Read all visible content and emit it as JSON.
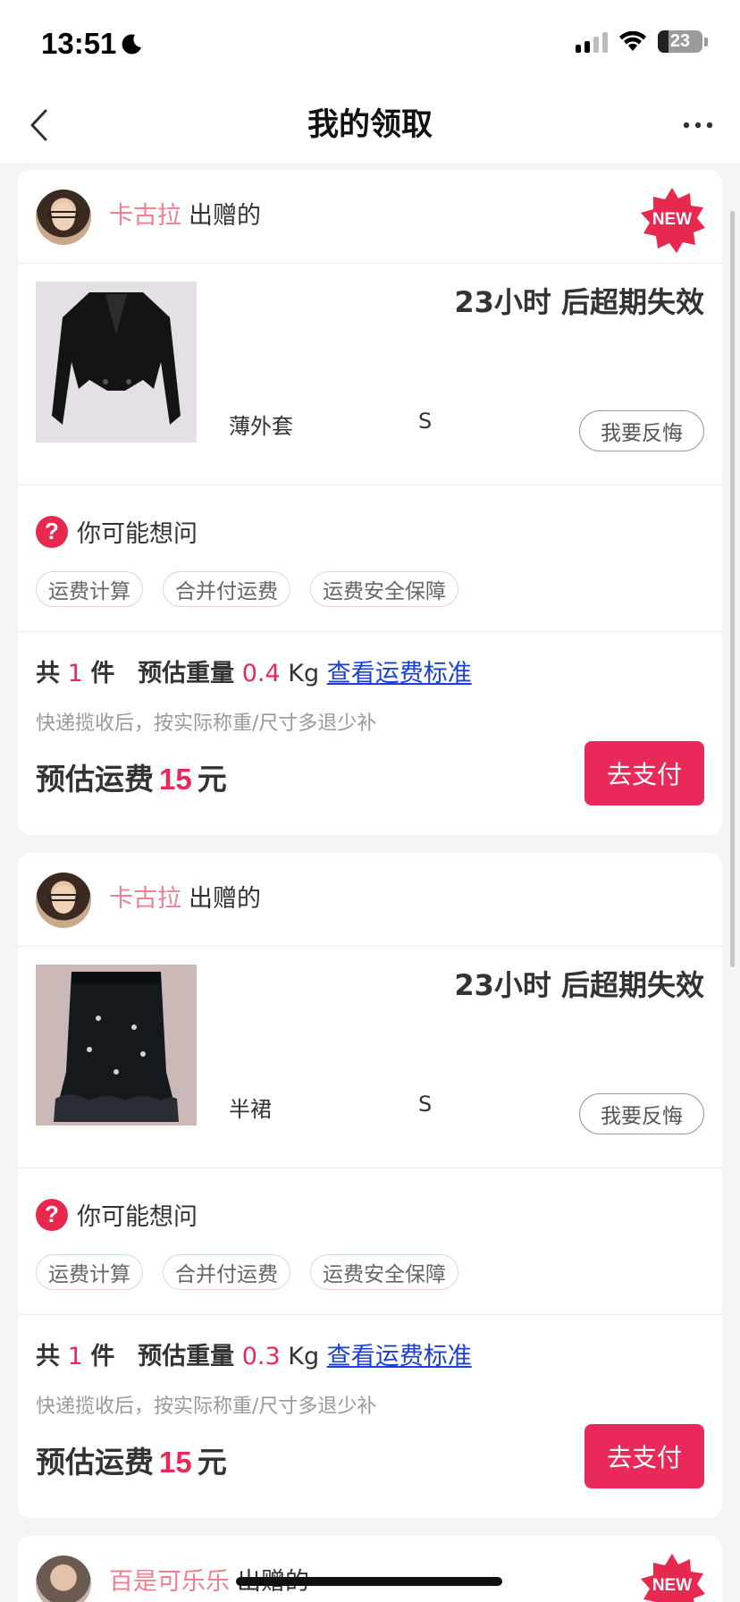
{
  "status": {
    "time": "13:51",
    "battery": "23",
    "moon_icon": "moon-icon",
    "signal_icon": "signal-icon",
    "wifi_icon": "wifi-icon"
  },
  "nav": {
    "title": "我的领取",
    "back_icon": "chevron-left-icon",
    "more_icon": "more-icon"
  },
  "colors": {
    "accent": "#e8295a",
    "giver_name": "#f07f8f",
    "link": "#1a3fd6"
  },
  "cards": [
    {
      "giver_name": "卡古拉",
      "giver_suffix": "出赠的",
      "badge": "NEW",
      "expire_text": "23小时 后超期失效",
      "product_name": "薄外套",
      "size": "S",
      "regret_label": "我要反悔",
      "faq_title": "你可能想问",
      "faq_tags": [
        "运费计算",
        "合并付运费",
        "运费安全保障"
      ],
      "count_prefix": "共",
      "count": "1",
      "count_unit": "件",
      "weight_label": "预估重量",
      "weight": "0.4",
      "weight_unit": "Kg",
      "shipping_link": "查看运费标准",
      "note": "快递揽收后，按实际称重/尺寸多退少补",
      "fee_label": "预估运费",
      "fee": "15",
      "fee_unit": "元",
      "pay_label": "去支付"
    },
    {
      "giver_name": "卡古拉",
      "giver_suffix": "出赠的",
      "expire_text": "23小时 后超期失效",
      "product_name": "半裙",
      "size": "S",
      "regret_label": "我要反悔",
      "faq_title": "你可能想问",
      "faq_tags": [
        "运费计算",
        "合并付运费",
        "运费安全保障"
      ],
      "count_prefix": "共",
      "count": "1",
      "count_unit": "件",
      "weight_label": "预估重量",
      "weight": "0.3",
      "weight_unit": "Kg",
      "shipping_link": "查看运费标准",
      "note": "快递揽收后，按实际称重/尺寸多退少补",
      "fee_label": "预估运费",
      "fee": "15",
      "fee_unit": "元",
      "pay_label": "去支付"
    },
    {
      "giver_name": "百是可乐乐",
      "giver_suffix": "出赠的",
      "badge": "NEW"
    }
  ]
}
